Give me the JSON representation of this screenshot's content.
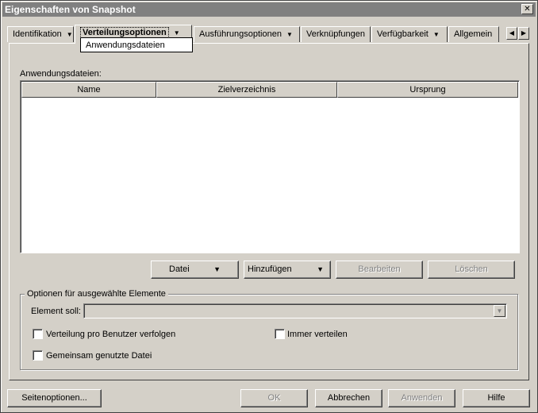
{
  "window": {
    "title": "Eigenschaften von Snapshot",
    "close_glyph": "✕"
  },
  "tabs": [
    {
      "label": "Identifikation",
      "has_menu": true
    },
    {
      "label": "Verteilungsoptionen",
      "has_menu": true,
      "active": true
    },
    {
      "label": "Ausführungsoptionen",
      "has_menu": true
    },
    {
      "label": "Verknüpfungen",
      "has_menu": false
    },
    {
      "label": "Verfügbarkeit",
      "has_menu": true
    },
    {
      "label": "Allgemein",
      "has_menu": false
    }
  ],
  "tab_scroll": {
    "left": "◀",
    "right": "▶"
  },
  "subtab": {
    "label": "Anwendungsdateien"
  },
  "files_section": {
    "label": "Anwendungsdateien:"
  },
  "table": {
    "columns": [
      "Name",
      "Zielverzeichnis",
      "Ursprung"
    ],
    "rows": []
  },
  "file_buttons": {
    "datei": "Datei",
    "hinzufuegen": "Hinzufügen",
    "bearbeiten": "Bearbeiten",
    "loeschen": "Löschen"
  },
  "options_group": {
    "title": "Optionen für ausgewählte Elemente",
    "element_label": "Element soll:",
    "element_value": "",
    "checkboxes": [
      {
        "label": "Verteilung pro Benutzer verfolgen",
        "checked": false
      },
      {
        "label": "Immer verteilen",
        "checked": false
      },
      {
        "label": "Gemeinsam genutzte Datei",
        "checked": false
      }
    ]
  },
  "footer": {
    "page_options": "Seitenoptionen...",
    "ok": "OK",
    "cancel": "Abbrechen",
    "apply": "Anwenden",
    "help": "Hilfe"
  },
  "colors": {
    "face": "#d4d0c8",
    "titlebar": "#808080",
    "disabled_text": "#808080"
  }
}
